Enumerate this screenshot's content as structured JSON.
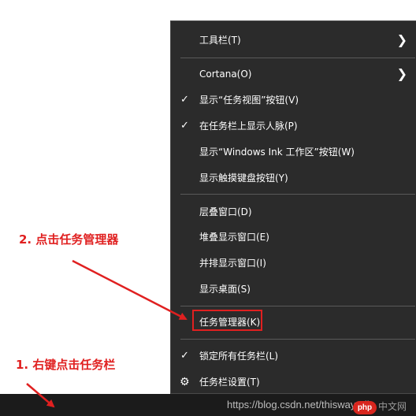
{
  "menu": {
    "toolbars": "工具栏(T)",
    "cortana": "Cortana(O)",
    "show_task_view": "显示“任务视图”按钮(V)",
    "show_people": "在任务栏上显示人脉(P)",
    "show_windows_ink": "显示“Windows Ink 工作区”按钮(W)",
    "show_touch_keyboard": "显示触摸键盘按钮(Y)",
    "cascade": "层叠窗口(D)",
    "stacked": "堆叠显示窗口(E)",
    "side_by_side": "并排显示窗口(I)",
    "show_desktop": "显示桌面(S)",
    "task_manager": "任务管理器(K)",
    "lock_taskbars": "锁定所有任务栏(L)",
    "taskbar_settings": "任务栏设置(T)"
  },
  "icons": {
    "check": "check-icon",
    "chevron": "chevron-right-icon",
    "gear": "gear-icon"
  },
  "annotations": {
    "step1": "1. 右键点击任务栏",
    "step2": "2. 点击任务管理器"
  },
  "watermark": "https://blog.csdn.net/thisway_diy",
  "logo": {
    "php": "php",
    "cn": "中文网"
  },
  "colors": {
    "menu_bg": "#2b2b2b",
    "annotation_red": "#e02020",
    "taskbar_bg": "#1b1b1b"
  }
}
